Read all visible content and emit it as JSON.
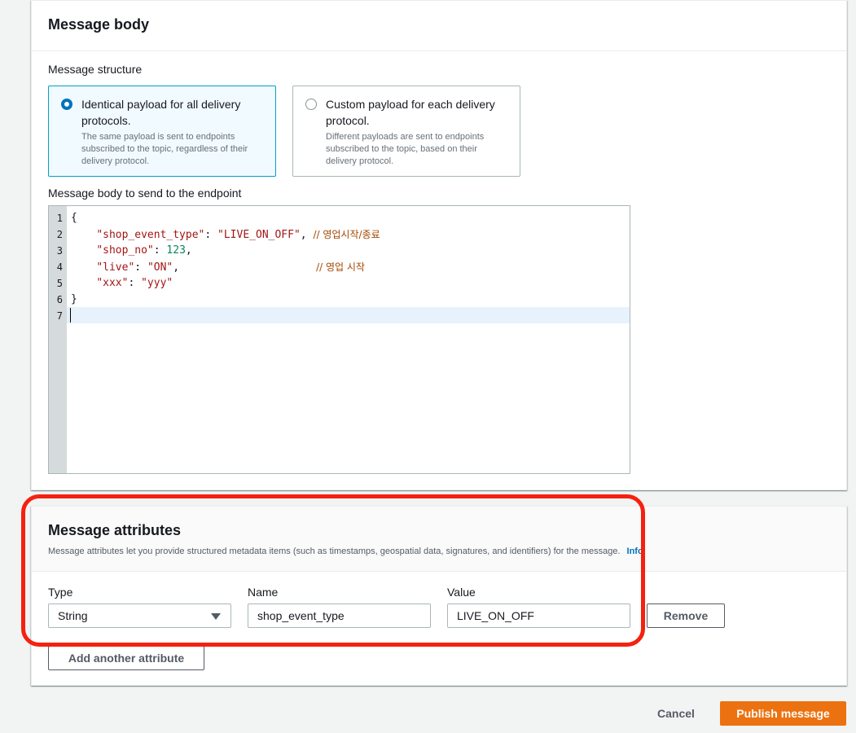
{
  "message_body": {
    "title": "Message body",
    "structure_label": "Message structure",
    "options": [
      {
        "title": "Identical payload for all delivery protocols.",
        "description": "The same payload is sent to endpoints subscribed to the topic, regardless of their delivery protocol.",
        "selected": true
      },
      {
        "title": "Custom payload for each delivery protocol.",
        "description": "Different payloads are sent to endpoints subscribed to the topic, based on their delivery protocol.",
        "selected": false
      }
    ],
    "editor_label": "Message body to send to the endpoint",
    "code": {
      "line_numbers": [
        "1",
        "2",
        "3",
        "4",
        "5",
        "6",
        "7"
      ],
      "l1_brace": "{",
      "l2_key": "\"shop_event_type\"",
      "l2_colon": ": ",
      "l2_val": "\"LIVE_ON_OFF\"",
      "l2_comma": ", ",
      "l2_comment": "// 영업시작/종료",
      "l3_key": "\"shop_no\"",
      "l3_colon": ": ",
      "l3_val": "123",
      "l3_comma": ",",
      "l4_key": "\"live\"",
      "l4_colon": ": ",
      "l4_val": "\"ON\"",
      "l4_comma": ",",
      "l4_comment": "// 영업 시작",
      "l5_key": "\"xxx\"",
      "l5_colon": ": ",
      "l5_val": "\"yyy\"",
      "l6_brace": "}"
    }
  },
  "message_attributes": {
    "title": "Message attributes",
    "description": "Message attributes let you provide structured metadata items (such as timestamps, geospatial data, signatures, and identifiers) for the message.",
    "info_link": "Info",
    "type_label": "Type",
    "name_label": "Name",
    "value_label": "Value",
    "type_value": "String",
    "name_value": "shop_event_type",
    "value_value": "LIVE_ON_OFF",
    "remove_button": "Remove",
    "add_button": "Add another attribute"
  },
  "footer": {
    "cancel": "Cancel",
    "publish": "Publish message"
  },
  "colors": {
    "accent": "#0073bb",
    "primary_button": "#ec7211",
    "highlight": "#f5210f"
  }
}
